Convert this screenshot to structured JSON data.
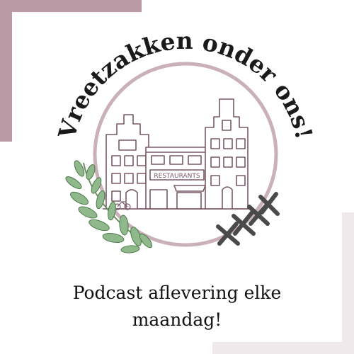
{
  "logo": {
    "title": "Vreetzakken onder ons!",
    "sign": "RESTAURANTS"
  },
  "tagline": {
    "line1": "Podcast aflevering elke",
    "line2": "maandag!"
  },
  "colors": {
    "accent_mauve": "#b99aa5",
    "accent_pale": "#f0e9eb",
    "circle": "#c9b0b9",
    "building_line": "#7a5868",
    "leaf": "#8fb98a",
    "leaf_dark": "#4d7a4d",
    "cross": "#4a4a4a",
    "text": "#111111"
  }
}
